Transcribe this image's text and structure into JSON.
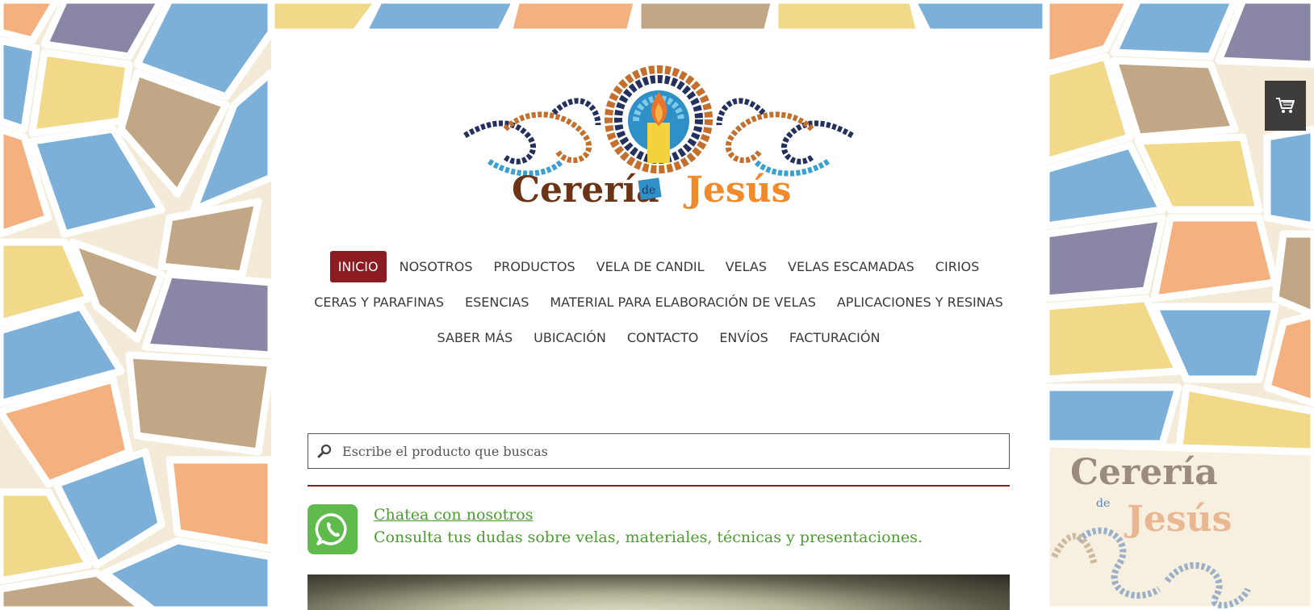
{
  "brand": {
    "name_part1": "Cerería",
    "name_connector": "de",
    "name_part2": "Jesús"
  },
  "nav": {
    "rows": [
      [
        {
          "label": "INICIO",
          "active": true
        },
        {
          "label": "NOSOTROS"
        },
        {
          "label": "PRODUCTOS"
        },
        {
          "label": "VELA DE CANDIL"
        },
        {
          "label": "VELAS"
        },
        {
          "label": "VELAS ESCAMADAS"
        },
        {
          "label": "CIRIOS"
        }
      ],
      [
        {
          "label": "CERAS Y PARAFINAS"
        },
        {
          "label": "ESENCIAS"
        },
        {
          "label": "MATERIAL PARA ELABORACIÓN DE VELAS"
        },
        {
          "label": "APLICACIONES Y RESINAS"
        }
      ],
      [
        {
          "label": "SABER MÁS"
        },
        {
          "label": "UBICACIÓN"
        },
        {
          "label": "CONTACTO"
        },
        {
          "label": "ENVÍOS"
        },
        {
          "label": "FACTURACIÓN"
        }
      ]
    ]
  },
  "search": {
    "placeholder": "Escribe el producto que buscas",
    "value": ""
  },
  "chat": {
    "link_label": "Chatea con nosotros",
    "description": "Consulta tus dudas sobre velas, materiales, técnicas y presentaciones."
  },
  "icons": {
    "search": "magnifier-icon",
    "whatsapp": "whatsapp-icon",
    "cart": "cart-icon"
  },
  "colors": {
    "accent": "#8d1b22",
    "chat_green": "#4a9e2c",
    "whatsapp_green": "#5fbb4b",
    "cart_bg": "#3f3d3b"
  }
}
